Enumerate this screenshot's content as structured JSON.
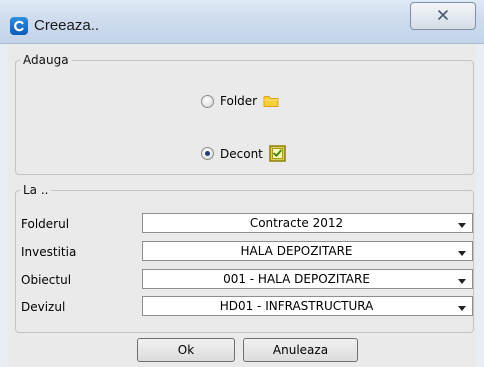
{
  "window": {
    "title": "Creeaza..",
    "icon": "app-icon-c",
    "close_icon": "close-icon"
  },
  "adauga": {
    "legend": "Adauga",
    "options": [
      {
        "label": "Folder",
        "checked": false,
        "icon": "folder-icon"
      },
      {
        "label": "Decont",
        "checked": true,
        "icon": "checkmark-icon"
      }
    ]
  },
  "la": {
    "legend": "La ..",
    "fields": [
      {
        "label": "Folderul",
        "value": "Contracte 2012"
      },
      {
        "label": "Investitia",
        "value": "HALA DEPOZITARE"
      },
      {
        "label": "Obiectul",
        "value": "001 - HALA DEPOZITARE"
      },
      {
        "label": "Devizul",
        "value": "HD01 - INFRASTRUCTURA"
      }
    ]
  },
  "buttons": {
    "ok_label": "Ok",
    "cancel_label": "Anuleaza"
  },
  "colors": {
    "folder": "#f5c518",
    "checkbox": "#b8a000",
    "radio_selected": "#1f3f7a"
  }
}
